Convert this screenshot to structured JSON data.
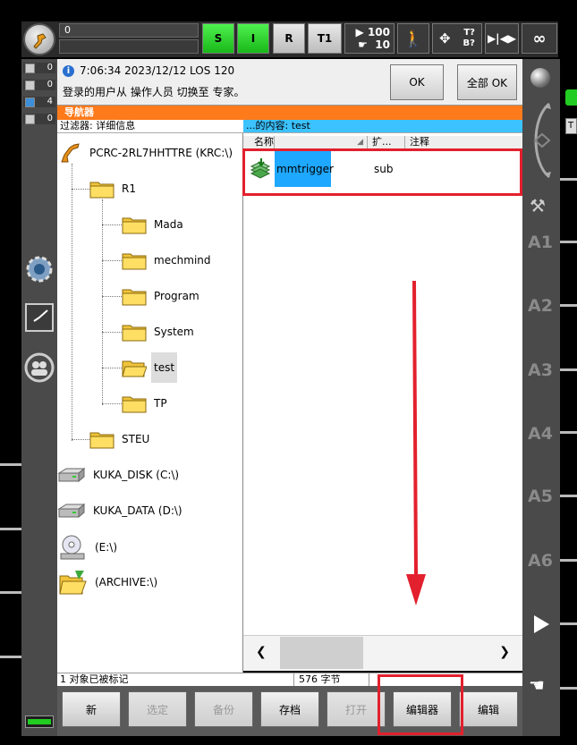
{
  "top": {
    "override_value": "0",
    "buttons": {
      "s": "S",
      "i": "I",
      "r": "R",
      "mode": "T1"
    },
    "speed_program": "100",
    "speed_jog": "10",
    "tool_text_top": "T?",
    "tool_text_bottom": "B?",
    "infinity": "∞"
  },
  "left_counters": [
    "0",
    "0",
    "4",
    "0"
  ],
  "message": {
    "time": "7:06:34 2023/12/12 LOS 120",
    "text": "登录的用户从 操作人员 切换至 专家。",
    "ok_label": "OK",
    "all_ok_label": "全部 OK"
  },
  "navigator": {
    "title": "导航器",
    "filter": "过滤器: 详细信息",
    "content_title": "...的内容: test",
    "tree": {
      "root": "PCRC-2RL7HHTTRE (KRC:\\)",
      "r1": "R1",
      "children": [
        "Mada",
        "mechmind",
        "Program",
        "System",
        "test",
        "TP"
      ],
      "steu": "STEU",
      "kuka_disk": "KUKA_DISK (C:\\)",
      "kuka_data": "KUKA_DATA (D:\\)",
      "drive_e": "(E:\\)",
      "archive": "(ARCHIVE:\\)"
    },
    "columns": {
      "name": "名称",
      "ext": "扩...",
      "comment": "注释"
    },
    "files": [
      {
        "name": "mmtrigger",
        "ext": "sub",
        "comment": ""
      }
    ],
    "status_left": "1 对象已被标记",
    "status_right": "576 字节"
  },
  "bottom_buttons": {
    "new": "新",
    "select": "选定",
    "backup": "备份",
    "archive": "存档",
    "open": "打开",
    "editor": "编辑器",
    "edit": "编辑"
  },
  "axes": [
    "A1",
    "A2",
    "A3",
    "A4",
    "A5",
    "A6"
  ],
  "colors": {
    "accent_orange": "#ff7a1a",
    "selection_blue": "#3cc2ff",
    "status_green": "#22cc22",
    "highlight_red": "#e3202d"
  }
}
